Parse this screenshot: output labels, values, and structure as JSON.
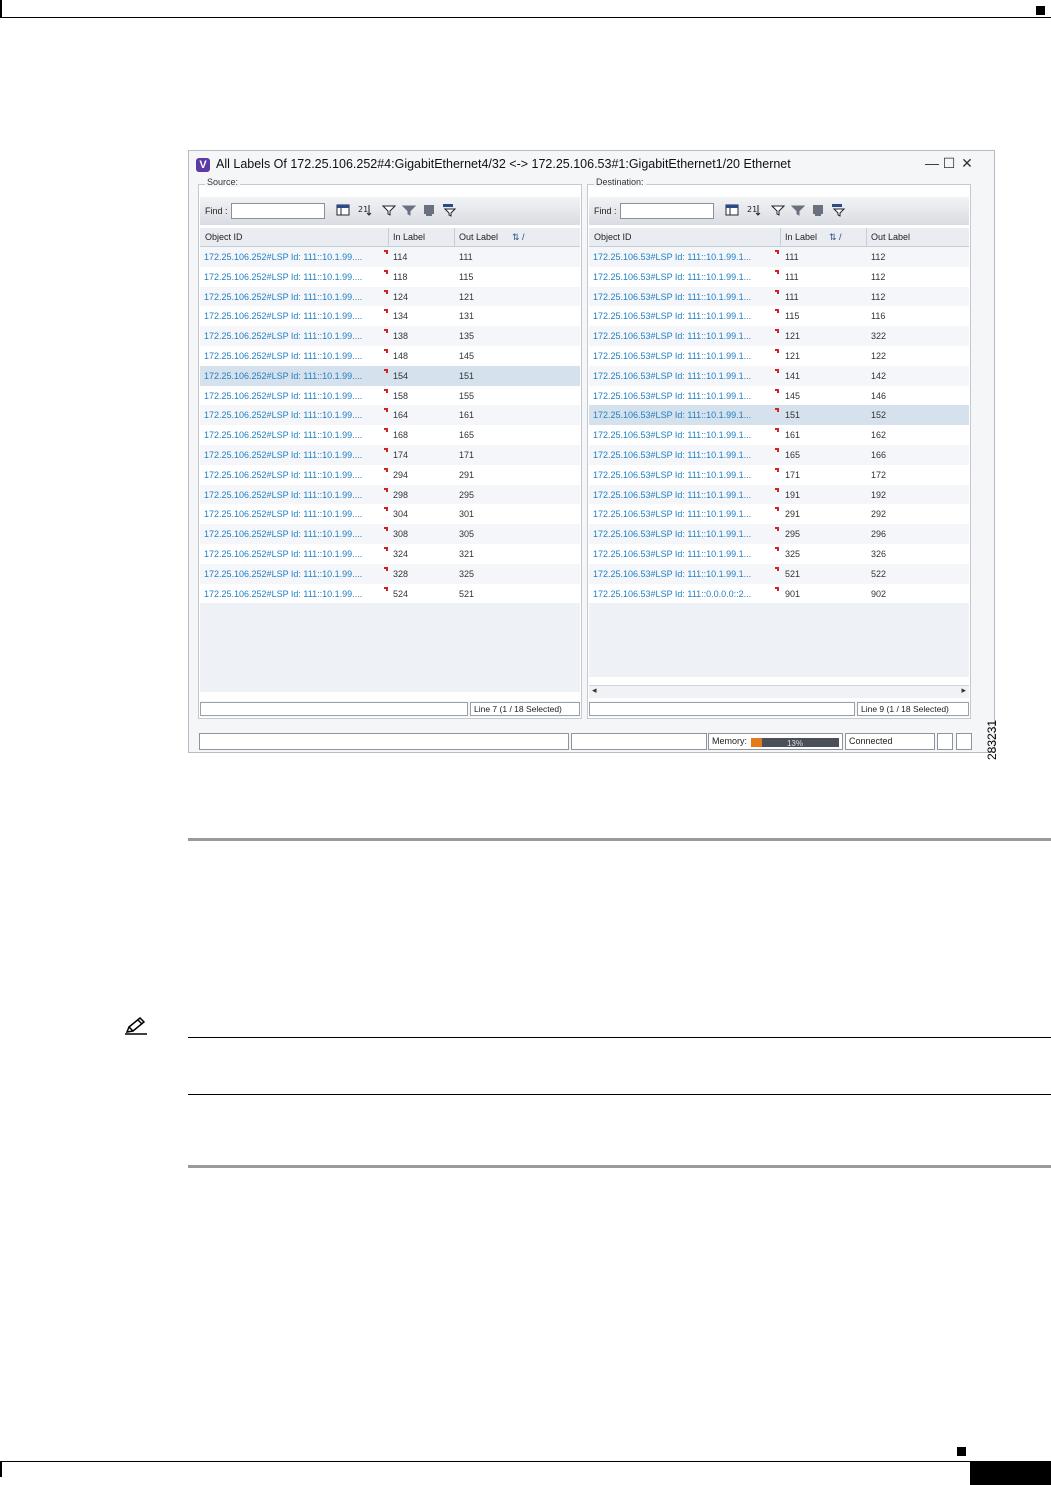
{
  "window": {
    "title": "All Labels Of 172.25.106.252#4:GigabitEthernet4/32 <-> 172.25.106.53#1:GigabitEthernet1/20 Ethernet",
    "app_icon_letter": "V",
    "minimize_glyph": "—",
    "maximize_glyph": "☐",
    "close_glyph": "✕"
  },
  "source": {
    "legend": "Source:",
    "find_label": "Find :",
    "columns": [
      "Object ID",
      "In Label",
      "Out Label"
    ],
    "sort_indicator": "⇅ /",
    "rows": [
      {
        "oid": "172.25.106.252#LSP Id: 111::10.1.99....",
        "in": "114",
        "out": "111"
      },
      {
        "oid": "172.25.106.252#LSP Id: 111::10.1.99....",
        "in": "118",
        "out": "115"
      },
      {
        "oid": "172.25.106.252#LSP Id: 111::10.1.99....",
        "in": "124",
        "out": "121"
      },
      {
        "oid": "172.25.106.252#LSP Id: 111::10.1.99....",
        "in": "134",
        "out": "131"
      },
      {
        "oid": "172.25.106.252#LSP Id: 111::10.1.99....",
        "in": "138",
        "out": "135"
      },
      {
        "oid": "172.25.106.252#LSP Id: 111::10.1.99....",
        "in": "148",
        "out": "145"
      },
      {
        "oid": "172.25.106.252#LSP Id: 111::10.1.99....",
        "in": "154",
        "out": "151"
      },
      {
        "oid": "172.25.106.252#LSP Id: 111::10.1.99....",
        "in": "158",
        "out": "155"
      },
      {
        "oid": "172.25.106.252#LSP Id: 111::10.1.99....",
        "in": "164",
        "out": "161"
      },
      {
        "oid": "172.25.106.252#LSP Id: 111::10.1.99....",
        "in": "168",
        "out": "165"
      },
      {
        "oid": "172.25.106.252#LSP Id: 111::10.1.99....",
        "in": "174",
        "out": "171"
      },
      {
        "oid": "172.25.106.252#LSP Id: 111::10.1.99....",
        "in": "294",
        "out": "291"
      },
      {
        "oid": "172.25.106.252#LSP Id: 111::10.1.99....",
        "in": "298",
        "out": "295"
      },
      {
        "oid": "172.25.106.252#LSP Id: 111::10.1.99....",
        "in": "304",
        "out": "301"
      },
      {
        "oid": "172.25.106.252#LSP Id: 111::10.1.99....",
        "in": "308",
        "out": "305"
      },
      {
        "oid": "172.25.106.252#LSP Id: 111::10.1.99....",
        "in": "324",
        "out": "321"
      },
      {
        "oid": "172.25.106.252#LSP Id: 111::10.1.99....",
        "in": "328",
        "out": "325"
      },
      {
        "oid": "172.25.106.252#LSP Id: 111::10.1.99....",
        "in": "524",
        "out": "521"
      }
    ],
    "selected_index": 6,
    "status": "Line 7 (1 / 18 Selected)"
  },
  "destination": {
    "legend": "Destination:",
    "find_label": "Find :",
    "columns": [
      "Object ID",
      "In Label",
      "Out Label"
    ],
    "sort_indicator": "⇅ /",
    "rows": [
      {
        "oid": "172.25.106.53#LSP Id: 111::10.1.99.1...",
        "in": "111",
        "out": "112"
      },
      {
        "oid": "172.25.106.53#LSP Id: 111::10.1.99.1...",
        "in": "111",
        "out": "112"
      },
      {
        "oid": "172.25.106.53#LSP Id: 111::10.1.99.1...",
        "in": "111",
        "out": "112"
      },
      {
        "oid": "172.25.106.53#LSP Id: 111::10.1.99.1...",
        "in": "115",
        "out": "116"
      },
      {
        "oid": "172.25.106.53#LSP Id: 111::10.1.99.1...",
        "in": "121",
        "out": "322"
      },
      {
        "oid": "172.25.106.53#LSP Id: 111::10.1.99.1...",
        "in": "121",
        "out": "122"
      },
      {
        "oid": "172.25.106.53#LSP Id: 111::10.1.99.1...",
        "in": "141",
        "out": "142"
      },
      {
        "oid": "172.25.106.53#LSP Id: 111::10.1.99.1...",
        "in": "145",
        "out": "146"
      },
      {
        "oid": "172.25.106.53#LSP Id: 111::10.1.99.1...",
        "in": "151",
        "out": "152"
      },
      {
        "oid": "172.25.106.53#LSP Id: 111::10.1.99.1...",
        "in": "161",
        "out": "162"
      },
      {
        "oid": "172.25.106.53#LSP Id: 111::10.1.99.1...",
        "in": "165",
        "out": "166"
      },
      {
        "oid": "172.25.106.53#LSP Id: 111::10.1.99.1...",
        "in": "171",
        "out": "172"
      },
      {
        "oid": "172.25.106.53#LSP Id: 111::10.1.99.1...",
        "in": "191",
        "out": "192"
      },
      {
        "oid": "172.25.106.53#LSP Id: 111::10.1.99.1...",
        "in": "291",
        "out": "292"
      },
      {
        "oid": "172.25.106.53#LSP Id: 111::10.1.99.1...",
        "in": "295",
        "out": "296"
      },
      {
        "oid": "172.25.106.53#LSP Id: 111::10.1.99.1...",
        "in": "325",
        "out": "326"
      },
      {
        "oid": "172.25.106.53#LSP Id: 111::10.1.99.1...",
        "in": "521",
        "out": "522"
      },
      {
        "oid": "172.25.106.53#LSP Id: 111::0.0.0.0::2...",
        "in": "901",
        "out": "902"
      }
    ],
    "selected_index": 8,
    "status": "Line 9 (1 / 18 Selected)",
    "scroll_left": "◂",
    "scroll_right": "▸"
  },
  "statusbar": {
    "memory_label": "Memory:",
    "memory_percent": "13%",
    "memory_fraction": 0.13,
    "connection": "Connected"
  },
  "figure_id": "283231",
  "colors": {
    "link": "#1f7fc4",
    "selected_row": "#d5e1ec",
    "memory_fill": "#e37b1d"
  }
}
